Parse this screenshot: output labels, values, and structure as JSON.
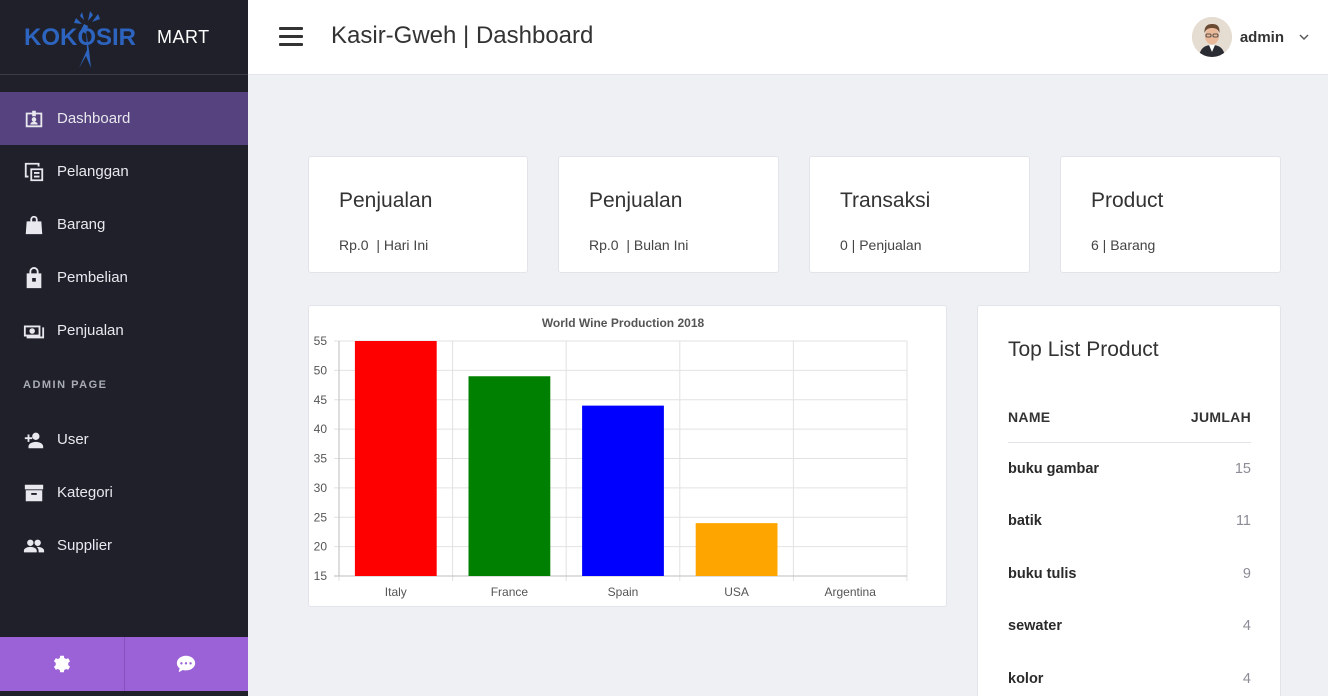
{
  "brand": {
    "logo_text": "KOKOSIR",
    "mart": "MART"
  },
  "sidebar": {
    "items": [
      {
        "label": "Dashboard",
        "icon": "id-card-icon",
        "active": true
      },
      {
        "label": "Pelanggan",
        "icon": "clone-icon"
      },
      {
        "label": "Barang",
        "icon": "shopping-bag-icon"
      },
      {
        "label": "Pembelian",
        "icon": "shopping-bag-lock-icon"
      },
      {
        "label": "Penjualan",
        "icon": "money-bill-icon"
      }
    ],
    "admin_header": "ADMIN PAGE",
    "admin_items": [
      {
        "label": "User",
        "icon": "user-plus-icon"
      },
      {
        "label": "Kategori",
        "icon": "archive-icon"
      },
      {
        "label": "Supplier",
        "icon": "users-icon"
      }
    ],
    "footer": [
      "gear-icon",
      "comment-icon"
    ]
  },
  "header": {
    "title": "Kasir-Gweh | Dashboard",
    "user": "admin"
  },
  "stats": [
    {
      "title": "Penjualan",
      "sub": "Rp.0  | Hari Ini"
    },
    {
      "title": "Penjualan",
      "sub": "Rp.0  | Bulan Ini"
    },
    {
      "title": "Transaksi",
      "sub": "0 | Penjualan"
    },
    {
      "title": "Product",
      "sub": "6 | Barang"
    }
  ],
  "chart_data": {
    "type": "bar",
    "title": "World Wine Production 2018",
    "categories": [
      "Italy",
      "France",
      "Spain",
      "USA",
      "Argentina"
    ],
    "values": [
      55,
      49,
      44,
      24,
      14
    ],
    "colors": [
      "#ff0000",
      "#008000",
      "#0000ff",
      "#ffa500",
      "#a52a2a"
    ],
    "ylim": [
      15,
      55
    ],
    "yticks": [
      15,
      20,
      25,
      30,
      35,
      40,
      45,
      50,
      55
    ],
    "grid": true
  },
  "top_list": {
    "title": "Top List Product",
    "col_name": "NAME",
    "col_qty": "JUMLAH",
    "rows": [
      {
        "name": "buku gambar",
        "qty": "15"
      },
      {
        "name": "batik",
        "qty": "11"
      },
      {
        "name": "buku tulis",
        "qty": "9"
      },
      {
        "name": "sewater",
        "qty": "4"
      },
      {
        "name": "kolor",
        "qty": "4"
      }
    ]
  }
}
